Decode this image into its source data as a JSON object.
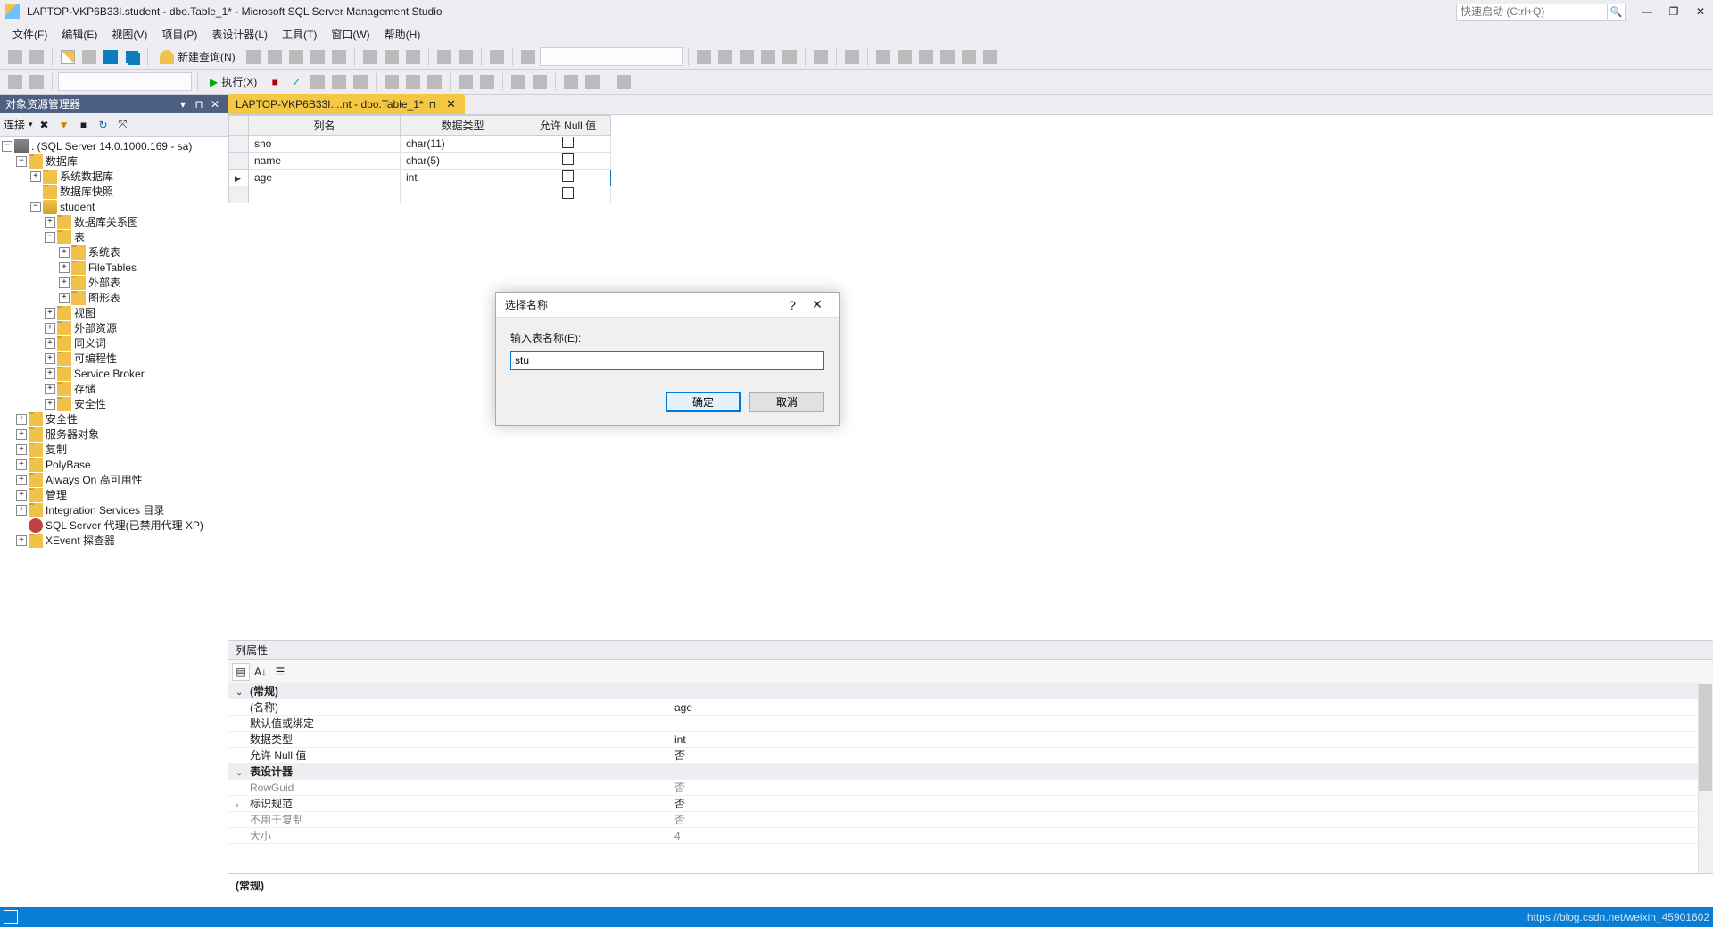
{
  "window": {
    "title": "LAPTOP-VKP6B33I.student - dbo.Table_1* - Microsoft SQL Server Management Studio",
    "quick_launch_placeholder": "快速启动 (Ctrl+Q)"
  },
  "menubar": [
    "文件(F)",
    "编辑(E)",
    "视图(V)",
    "项目(P)",
    "表设计器(L)",
    "工具(T)",
    "窗口(W)",
    "帮助(H)"
  ],
  "toolbar_main": {
    "new_query": "新建查询(N)",
    "execute": "执行(X)"
  },
  "object_explorer": {
    "title": "对象资源管理器",
    "connect_label": "连接",
    "root": ". (SQL Server 14.0.1000.169 - sa)",
    "tree": {
      "databases": "数据库",
      "system_dbs": "系统数据库",
      "db_snapshots": "数据库快照",
      "student": "student",
      "diagrams": "数据库关系图",
      "tables": "表",
      "system_tables": "系统表",
      "file_tables": "FileTables",
      "external_tables": "外部表",
      "graph_tables": "图形表",
      "views": "视图",
      "external_resources": "外部资源",
      "synonyms": "同义词",
      "programmability": "可编程性",
      "service_broker": "Service Broker",
      "storage": "存储",
      "security_db": "安全性",
      "security": "安全性",
      "server_objects": "服务器对象",
      "replication": "复制",
      "polybase": "PolyBase",
      "always_on": "Always On 高可用性",
      "management": "管理",
      "integration_services": "Integration Services 目录",
      "sql_agent": "SQL Server 代理(已禁用代理 XP)",
      "xevent": "XEvent 探查器"
    }
  },
  "tab": {
    "label": "LAPTOP-VKP6B33I....nt - dbo.Table_1*"
  },
  "column_grid": {
    "headers": {
      "name": "列名",
      "datatype": "数据类型",
      "nulls": "允许 Null 值"
    },
    "rows": [
      {
        "name": "sno",
        "datatype": "char(11)",
        "nulls": false,
        "selected": false
      },
      {
        "name": "name",
        "datatype": "char(5)",
        "nulls": false,
        "selected": false
      },
      {
        "name": "age",
        "datatype": "int",
        "nulls": false,
        "selected": true
      },
      {
        "name": "",
        "datatype": "",
        "nulls": false,
        "selected": false,
        "empty": true
      }
    ]
  },
  "column_props": {
    "title": "列属性",
    "groups": {
      "general": "(常规)",
      "designer": "表设计器"
    },
    "rows": [
      {
        "key": "(名称)",
        "val": "age"
      },
      {
        "key": "默认值或绑定",
        "val": ""
      },
      {
        "key": "数据类型",
        "val": "int"
      },
      {
        "key": "允许 Null 值",
        "val": "否"
      }
    ],
    "designer_rows": [
      {
        "key": "RowGuid",
        "val": "否",
        "gray": true
      },
      {
        "key": "标识规范",
        "val": "否",
        "expandable": true
      },
      {
        "key": "不用于复制",
        "val": "否",
        "gray": true
      },
      {
        "key": "大小",
        "val": "4",
        "gray": true
      }
    ],
    "summary": "(常规)"
  },
  "dialog": {
    "title": "选择名称",
    "label": "输入表名称(E):",
    "value": "stu",
    "ok": "确定",
    "cancel": "取消",
    "help": "?"
  },
  "statusbar": {
    "watermark": "https://blog.csdn.net/weixin_45901602"
  }
}
